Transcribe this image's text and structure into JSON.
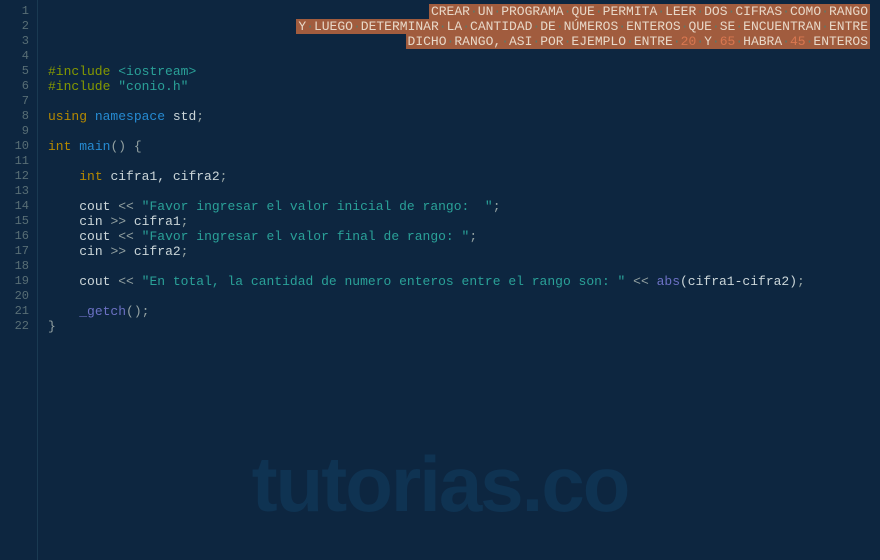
{
  "lineNumbers": [
    "1",
    "2",
    "3",
    "4",
    "5",
    "6",
    "7",
    "8",
    "9",
    "10",
    "11",
    "12",
    "13",
    "14",
    "15",
    "16",
    "17",
    "18",
    "19",
    "20",
    "21",
    "22"
  ],
  "comment": {
    "l1_parts": [
      "CREAR",
      "UN",
      "PROGRAMA",
      "QUE",
      "PERMITA",
      "LEER",
      "DOS",
      "CIFRAS",
      "COMO",
      "RANGO"
    ],
    "l2_parts": [
      "Y",
      "LUEGO",
      "DETERMINAR",
      "LA",
      "CANTIDAD",
      "DE",
      "NÚMEROS",
      "ENTEROS",
      "QUE",
      "SE",
      "ENCUENTRAN",
      "ENTRE"
    ],
    "l3_a_parts": [
      "DICHO",
      "RANGO,",
      "ASI",
      "POR",
      "EJEMPLO",
      "ENTRE"
    ],
    "l3_n1": "20",
    "l3_mid": "Y",
    "l3_n2": "65",
    "l3_b": "HABRA",
    "l3_n3": "45",
    "l3_c": "ENTEROS"
  },
  "code": {
    "include": "#include",
    "iostream": "<iostream>",
    "conio": "\"conio.h\"",
    "using": "using",
    "namespace": "namespace",
    "std": "std",
    "int": "int",
    "main": "main",
    "lparen": "(",
    "rparen": ")",
    "lbrace": "{",
    "rbrace": "}",
    "cifra_decl": "cifra1, cifra2",
    "cout": "cout",
    "cin": "cin",
    "lshift": "<<",
    "rshift": ">>",
    "str1": "\"Favor ingresar el valor inicial de rango:  \"",
    "str2": "\"Favor ingresar el valor final de rango: \"",
    "str3": "\"En total, la cantidad de numero enteros entre el rango son: \"",
    "cifra1": "cifra1",
    "cifra2": "cifra2",
    "abs": "abs",
    "absarg": "(cifra1-cifra2)",
    "getch": "_getch",
    "getcharg": "()",
    "semi": ";"
  },
  "watermark": "tutorias.co"
}
